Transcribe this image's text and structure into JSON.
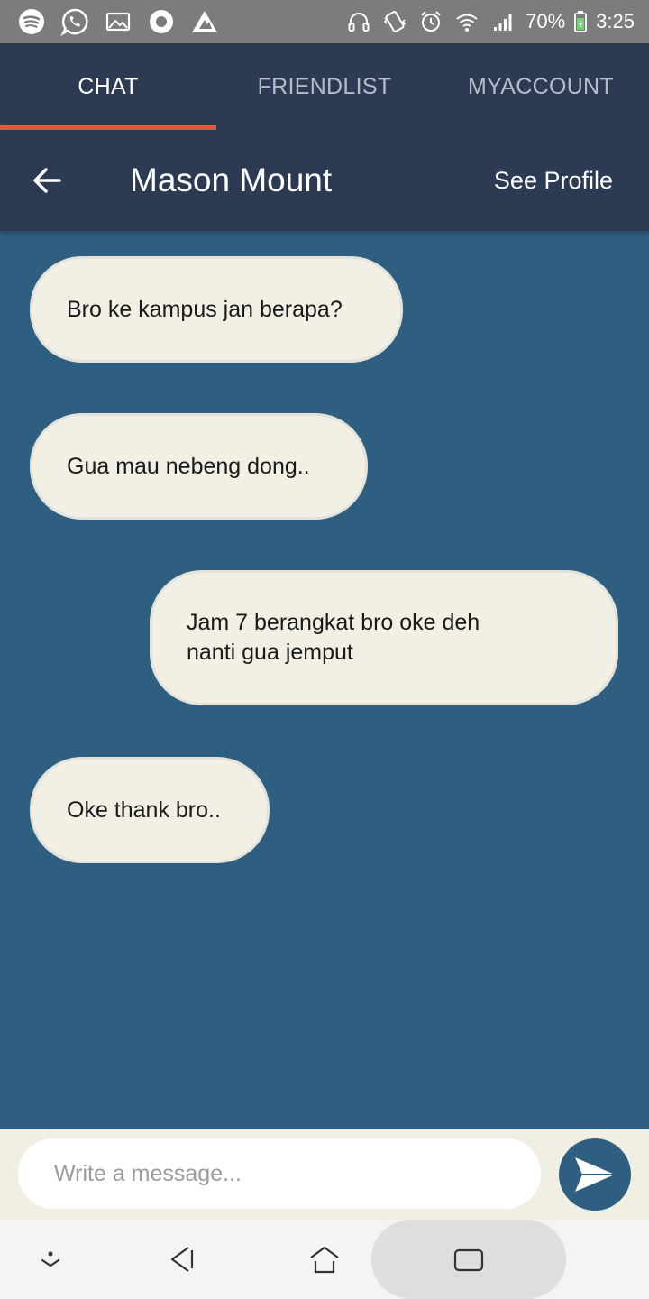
{
  "status_bar": {
    "left_icons": [
      "spotify-icon",
      "whatsapp-icon",
      "gallery-icon",
      "circle-app-icon",
      "warning-icon"
    ],
    "right_icons": [
      "headphones-icon",
      "vibrate-icon",
      "alarm-icon",
      "wifi-icon",
      "signal-icon"
    ],
    "battery": "70%",
    "time": "3:25"
  },
  "tabs": [
    {
      "label": "CHAT",
      "active": true
    },
    {
      "label": "FRIENDLIST",
      "active": false
    },
    {
      "label": "MYACCOUNT",
      "active": false
    }
  ],
  "chat_header": {
    "contact_name": "Mason Mount",
    "see_profile_label": "See Profile"
  },
  "messages": [
    {
      "text": "Bro ke kampus jan berapa?",
      "side": "left"
    },
    {
      "text": "Gua mau nebeng dong..",
      "side": "left"
    },
    {
      "text": "Jam 7 berangkat bro oke deh nanti gua jemput",
      "side": "right"
    },
    {
      "text": "Oke thank bro..",
      "side": "left"
    }
  ],
  "composer": {
    "placeholder": "Write a message..."
  },
  "colors": {
    "header_bg": "#2d3a54",
    "chat_bg": "#2e5f80",
    "active_tab_underline": "#e4593a",
    "bubble_bg": "#f2efe4"
  }
}
